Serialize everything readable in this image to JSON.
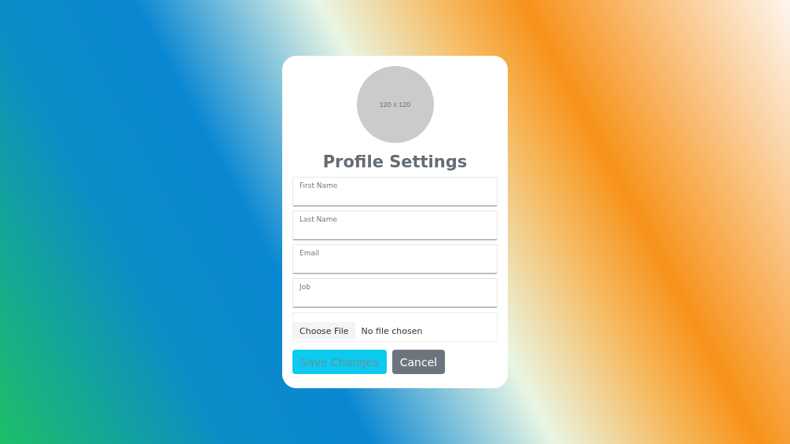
{
  "avatar": {
    "text": "120 x 120"
  },
  "title": "Profile Settings",
  "fields": [
    {
      "label": "First Name"
    },
    {
      "label": "Last Name"
    },
    {
      "label": "Email"
    },
    {
      "label": "Job"
    }
  ],
  "file": {
    "button": "Choose File",
    "status": "No file chosen"
  },
  "buttons": [
    {
      "label": "Save Changes",
      "kind": "primary"
    },
    {
      "label": "Cancel",
      "kind": "secondary"
    }
  ]
}
